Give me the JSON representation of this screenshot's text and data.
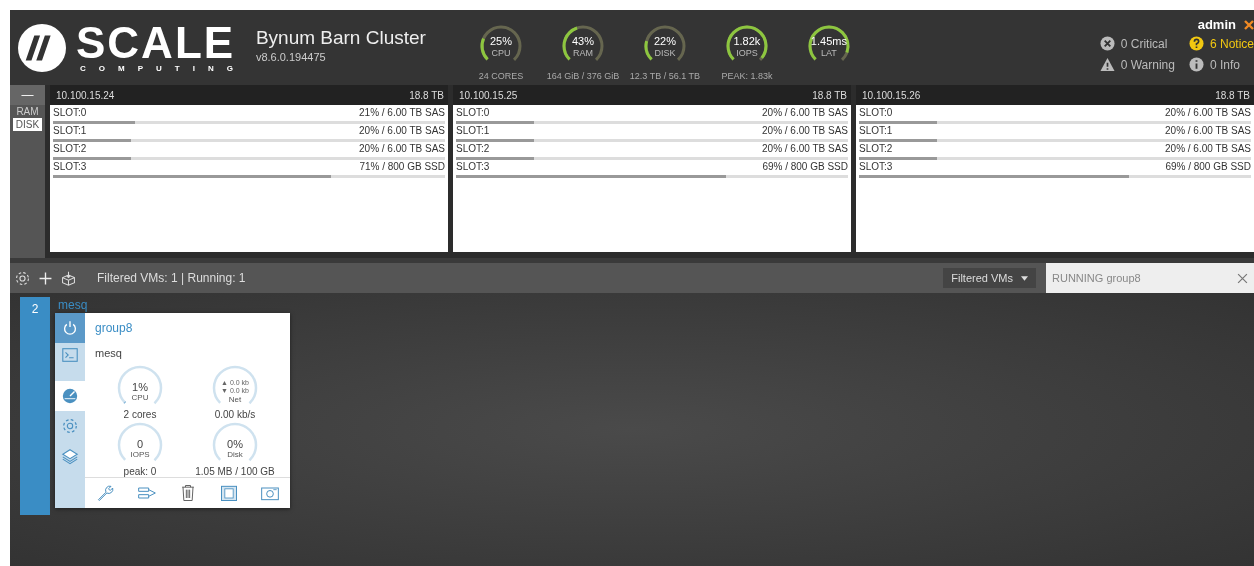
{
  "header": {
    "logo": {
      "word": "SCALE",
      "tagline": "COMPUTING"
    },
    "cluster_name": "Bynum Barn Cluster",
    "version": "v8.6.0.194475",
    "gauges": [
      {
        "value": "25%",
        "label": "CPU",
        "caption": "24 CORES"
      },
      {
        "value": "43%",
        "label": "RAM",
        "caption": "164 GiB / 376 GiB"
      },
      {
        "value": "22%",
        "label": "DISK",
        "caption": "12.3 TB / 56.1 TB"
      },
      {
        "value": "1.82k",
        "label": "IOPS",
        "caption": "PEAK: 1.83k"
      },
      {
        "value": "1.45ms",
        "label": "LAT"
      }
    ],
    "user": "admin",
    "alerts": [
      {
        "kind": "critical",
        "text": "0 Critical",
        "color": "#bbbbbb"
      },
      {
        "kind": "notice",
        "text": "6 Notice",
        "color": "#f2c811"
      },
      {
        "kind": "warning",
        "text": "0 Warning",
        "color": "#bbbbbb"
      },
      {
        "kind": "info",
        "text": "0 Info",
        "color": "#bbbbbb"
      }
    ]
  },
  "nodes_panel": {
    "collapse_button": "—",
    "tabs": [
      {
        "label": "RAM",
        "selected": false
      },
      {
        "label": "DISK",
        "selected": true
      }
    ],
    "nodes": [
      {
        "ip": "10.100.15.24",
        "capacity": "18.8 TB",
        "slots": [
          {
            "name": "SLOT:0",
            "reading": "21% / 6.00 TB SAS",
            "level": 0.21
          },
          {
            "name": "SLOT:1",
            "reading": "20% / 6.00 TB SAS",
            "level": 0.2
          },
          {
            "name": "SLOT:2",
            "reading": "20% / 6.00 TB SAS",
            "level": 0.2
          },
          {
            "name": "SLOT:3",
            "reading": "71% / 800 GB SSD",
            "level": 0.71
          }
        ]
      },
      {
        "ip": "10.100.15.25",
        "capacity": "18.8 TB",
        "slots": [
          {
            "name": "SLOT:0",
            "reading": "20% / 6.00 TB SAS",
            "level": 0.2
          },
          {
            "name": "SLOT:1",
            "reading": "20% / 6.00 TB SAS",
            "level": 0.2
          },
          {
            "name": "SLOT:2",
            "reading": "20% / 6.00 TB SAS",
            "level": 0.2
          },
          {
            "name": "SLOT:3",
            "reading": "69% / 800 GB SSD",
            "level": 0.69
          }
        ]
      },
      {
        "ip": "10.100.15.26",
        "capacity": "18.8 TB",
        "slots": [
          {
            "name": "SLOT:0",
            "reading": "20% / 6.00 TB SAS",
            "level": 0.2
          },
          {
            "name": "SLOT:1",
            "reading": "20% / 6.00 TB SAS",
            "level": 0.2
          },
          {
            "name": "SLOT:2",
            "reading": "20% / 6.00 TB SAS",
            "level": 0.2
          },
          {
            "name": "SLOT:3",
            "reading": "69% / 800 GB SSD",
            "level": 0.69
          }
        ]
      }
    ]
  },
  "toolbar": {
    "summary": "Filtered VMs: 1 | Running: 1",
    "filter_dropdown": "Filtered VMs",
    "search": {
      "value": "RUNNING group8"
    }
  },
  "vm_groups": [
    {
      "count": "2",
      "name": "mesq",
      "card": {
        "title": "group8",
        "description": "mesq",
        "side_tabs": [
          {
            "kind": "power",
            "selected": false
          },
          {
            "kind": "console",
            "selected": false
          },
          {
            "kind": "dashboard",
            "selected": true
          },
          {
            "kind": "settings",
            "selected": false
          },
          {
            "kind": "layers",
            "selected": false
          }
        ],
        "gauges": [
          {
            "kind": "percent",
            "value": "1%",
            "label": "CPU",
            "caption": "2 cores"
          },
          {
            "kind": "net",
            "up": "▲ 0.0 kb",
            "down": "▼ 0.0 kb",
            "label": "Net",
            "caption": "0.00 kb/s"
          },
          {
            "kind": "percent",
            "value": "0",
            "label": "IOPS",
            "caption": "peak: 0"
          },
          {
            "kind": "percent",
            "value": "0%",
            "label": "Disk",
            "caption": "1.05 MB / 100 GB"
          }
        ]
      }
    }
  ]
}
